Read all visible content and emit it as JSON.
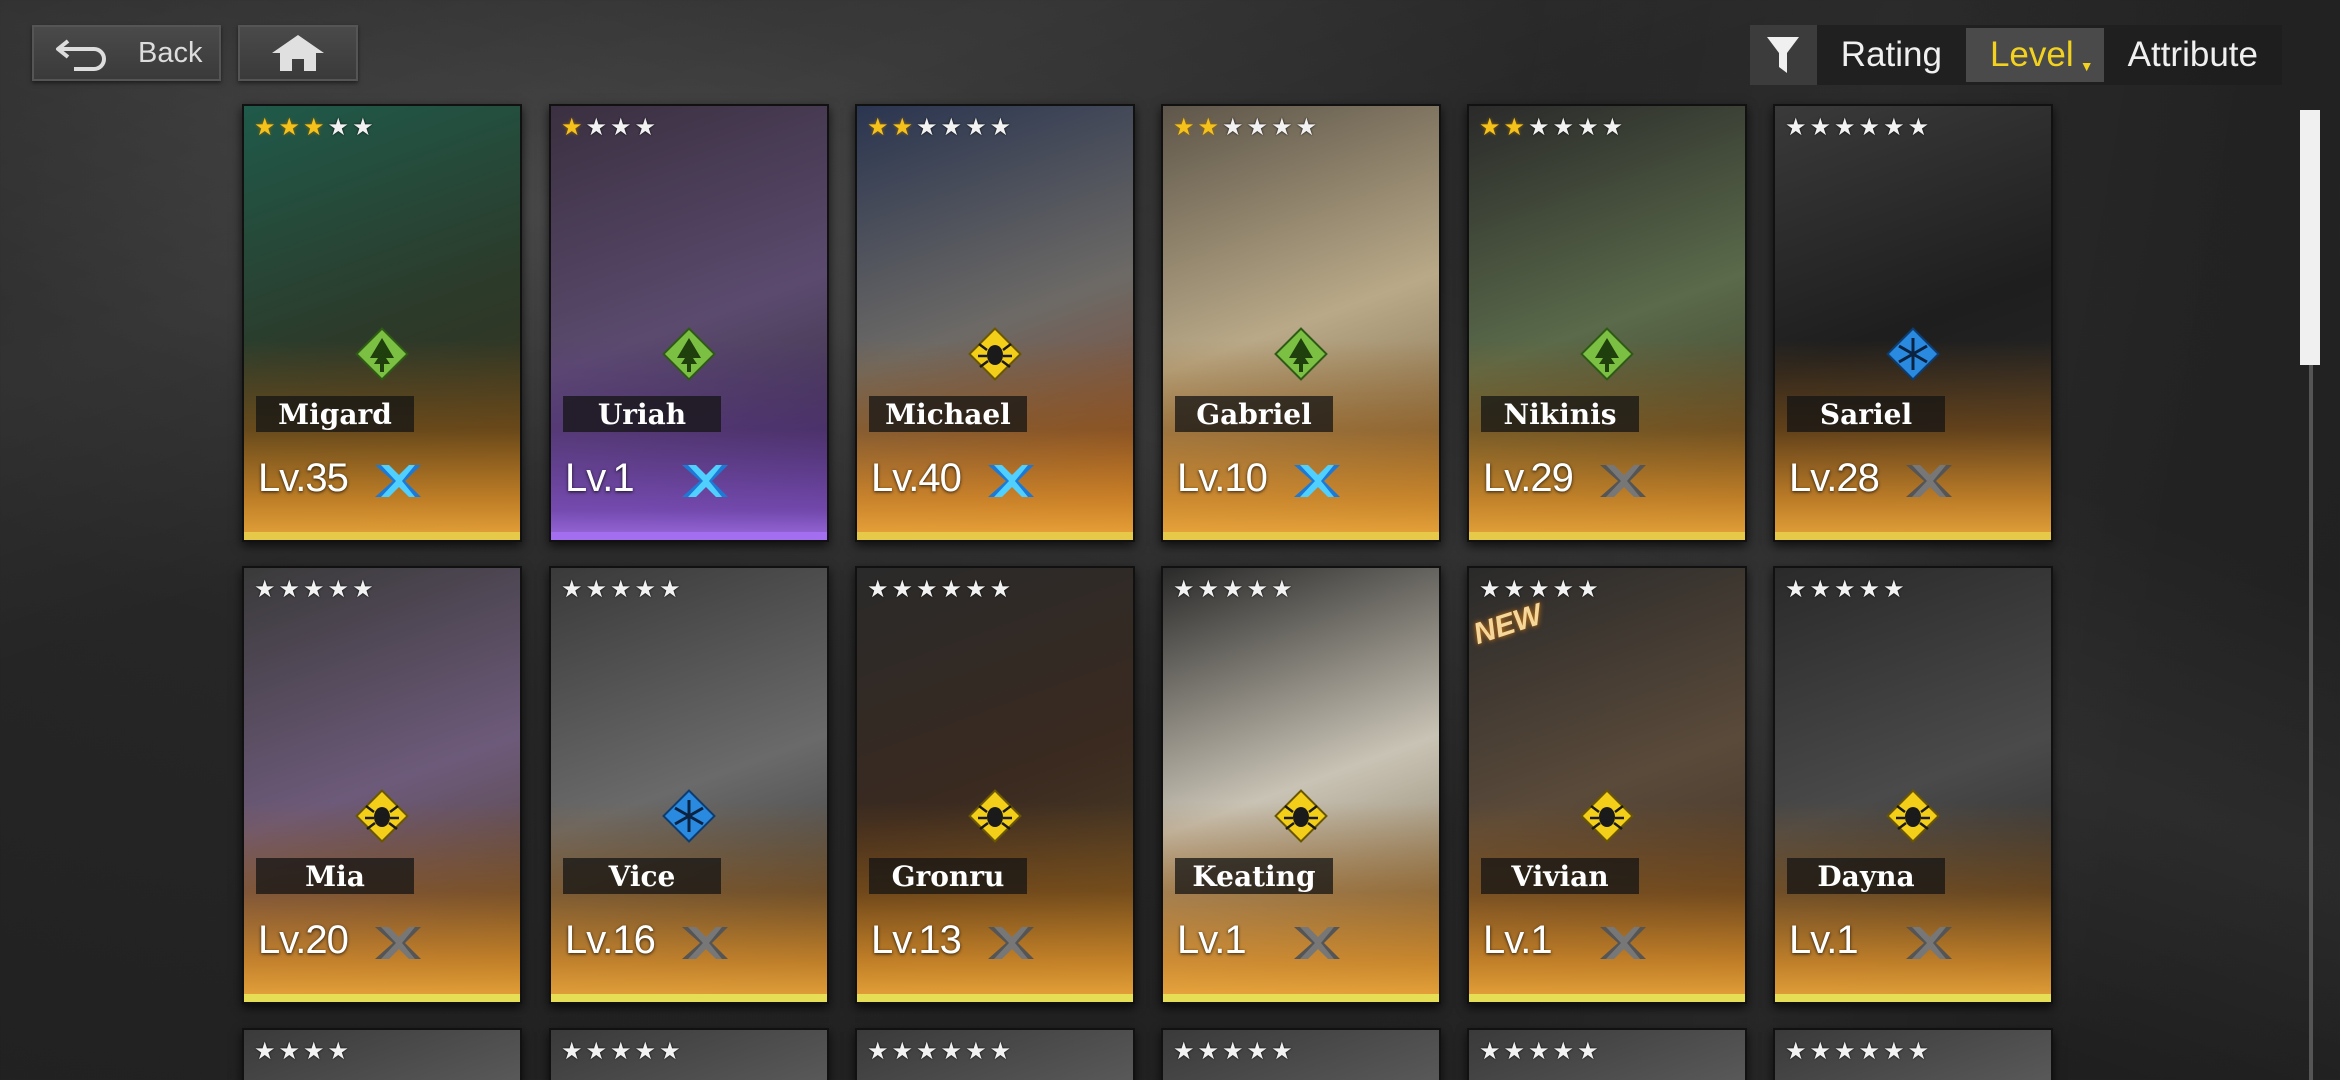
{
  "nav": {
    "back_label": "Back",
    "back_icon": "return-arrow-icon",
    "home_icon": "home-icon"
  },
  "sort": {
    "filter_icon": "filter-funnel-icon",
    "options": [
      "Rating",
      "Level",
      "Attribute"
    ],
    "active": "Level",
    "active_color": "#f3d21f"
  },
  "cards": [
    {
      "name": "Migard",
      "level": "Lv.35",
      "stars_gold": 3,
      "stars_total": 5,
      "attribute": "forest",
      "x_mark": "active",
      "frame": "gold",
      "colors": [
        "#1f5a4a",
        "#2c3a2a",
        "#3b2f1a"
      ]
    },
    {
      "name": "Uriah",
      "level": "Lv.1",
      "stars_gold": 1,
      "stars_total": 4,
      "attribute": "forest",
      "x_mark": "active",
      "frame": "purple",
      "colors": [
        "#3a3040",
        "#5b4a6e",
        "#2a2232"
      ]
    },
    {
      "name": "Michael",
      "level": "Lv.40",
      "stars_gold": 2,
      "stars_total": 6,
      "attribute": "spider",
      "x_mark": "active",
      "frame": "gold",
      "colors": [
        "#2a3550",
        "#6d6a66",
        "#8a3a1a"
      ]
    },
    {
      "name": "Gabriel",
      "level": "Lv.10",
      "stars_gold": 2,
      "stars_total": 6,
      "attribute": "forest",
      "x_mark": "active",
      "frame": "gold",
      "colors": [
        "#5e564a",
        "#b9a988",
        "#6b5433"
      ]
    },
    {
      "name": "Nikinis",
      "level": "Lv.29",
      "stars_gold": 2,
      "stars_total": 6,
      "attribute": "forest",
      "x_mark": "inactive",
      "frame": "gold",
      "colors": [
        "#2a2a2a",
        "#5a6a4a",
        "#3a3020"
      ]
    },
    {
      "name": "Sariel",
      "level": "Lv.28",
      "stars_gold": 0,
      "stars_total": 6,
      "attribute": "frost",
      "x_mark": "inactive",
      "frame": "gold",
      "colors": [
        "#3a3a3a",
        "#1e1e1e",
        "#2c2c2c"
      ]
    },
    {
      "name": "Mia",
      "level": "Lv.20",
      "stars_gold": 0,
      "stars_total": 5,
      "attribute": "spider",
      "x_mark": "inactive",
      "frame": "gold",
      "colors": [
        "#3a3a3a",
        "#6d5a7a",
        "#4a3a20"
      ]
    },
    {
      "name": "Vice",
      "level": "Lv.16",
      "stars_gold": 0,
      "stars_total": 5,
      "attribute": "frost",
      "x_mark": "inactive",
      "frame": "gold",
      "colors": [
        "#3a3a3a",
        "#6a6a6a",
        "#2a2a2a"
      ]
    },
    {
      "name": "Gronru",
      "level": "Lv.13",
      "stars_gold": 0,
      "stars_total": 6,
      "attribute": "spider",
      "x_mark": "inactive",
      "frame": "gold",
      "colors": [
        "#2a2a2a",
        "#3a2a20",
        "#5a4a2a"
      ]
    },
    {
      "name": "Keating",
      "level": "Lv.1",
      "stars_gold": 0,
      "stars_total": 5,
      "attribute": "spider",
      "x_mark": "inactive",
      "frame": "gold",
      "colors": [
        "#2a2a2a",
        "#c9c3b5",
        "#6a5a3a"
      ]
    },
    {
      "name": "Vivian",
      "level": "Lv.1",
      "stars_gold": 0,
      "stars_total": 5,
      "attribute": "spider",
      "x_mark": "inactive",
      "frame": "gold",
      "new_tag": "NEW",
      "colors": [
        "#2a2a2a",
        "#5a4a3a",
        "#3a2a20"
      ]
    },
    {
      "name": "Dayna",
      "level": "Lv.1",
      "stars_gold": 0,
      "stars_total": 5,
      "attribute": "spider",
      "x_mark": "inactive",
      "frame": "gold",
      "colors": [
        "#2a2a2a",
        "#4a4a4a",
        "#1e1e1e"
      ]
    }
  ],
  "partial_row_stars": [
    4,
    5,
    6,
    5,
    5,
    6
  ]
}
